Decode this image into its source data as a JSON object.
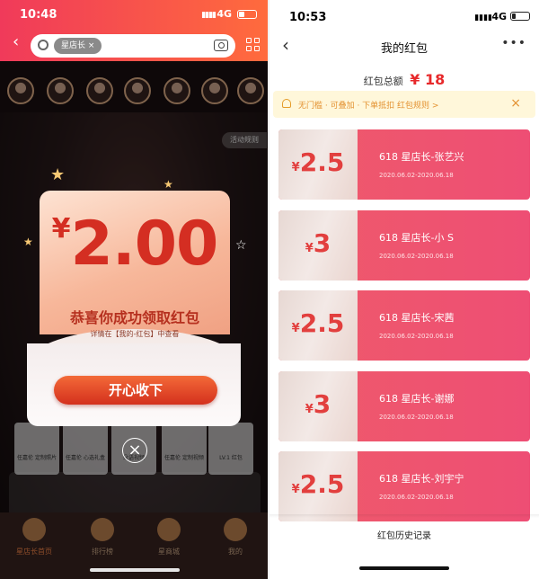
{
  "left": {
    "status": {
      "time": "10:48",
      "network": "4G"
    },
    "search": {
      "chip": "星店长",
      "chip_close": "×"
    },
    "scene": {
      "rule_button": "活动规则"
    },
    "goods": [
      "任嘉伦 定制照片",
      "任嘉伦 心选礼盒",
      "朵语视频",
      "任嘉伦 定制视频",
      "LV.1 红包"
    ],
    "popup": {
      "currency": "¥",
      "amount": "2.00",
      "title": "恭喜你成功领取红包",
      "subtitle": "详情在【我的-红包】中查看",
      "accept_button": "开心收下",
      "close": "×"
    },
    "tabs": [
      {
        "label": "星店长首页",
        "active": true
      },
      {
        "label": "排行榜",
        "active": false
      },
      {
        "label": "星商城",
        "active": false
      },
      {
        "label": "我的",
        "active": false
      }
    ]
  },
  "right": {
    "status": {
      "time": "10:53",
      "network": "4G"
    },
    "title": "我的红包",
    "more": "•••",
    "total_label": "红包总额",
    "total_currency": "¥",
    "total_value": "18",
    "notice": "无门槛 · 可叠加 · 下单抵扣   红包规则 >",
    "notice_close": "×",
    "cards": [
      {
        "currency": "¥",
        "amount": "2.5",
        "name": "618 星店长-张艺兴",
        "date": "2020.06.02-2020.06.18"
      },
      {
        "currency": "¥",
        "amount": "3",
        "name": "618 星店长-小 S",
        "date": "2020.06.02-2020.06.18"
      },
      {
        "currency": "¥",
        "amount": "2.5",
        "name": "618 星店长-宋茜",
        "date": "2020.06.02-2020.06.18"
      },
      {
        "currency": "¥",
        "amount": "3",
        "name": "618 星店长-谢娜",
        "date": "2020.06.02-2020.06.18"
      },
      {
        "currency": "¥",
        "amount": "2.5",
        "name": "618 星店长-刘宇宁",
        "date": "2020.06.02-2020.06.18"
      }
    ],
    "history_link": "红包历史记录"
  },
  "colors": {
    "brand_red": "#e7292b",
    "card_pink": "#ee4e74",
    "notice_bg": "#fff7da",
    "accept_orange": "#f36a38"
  }
}
